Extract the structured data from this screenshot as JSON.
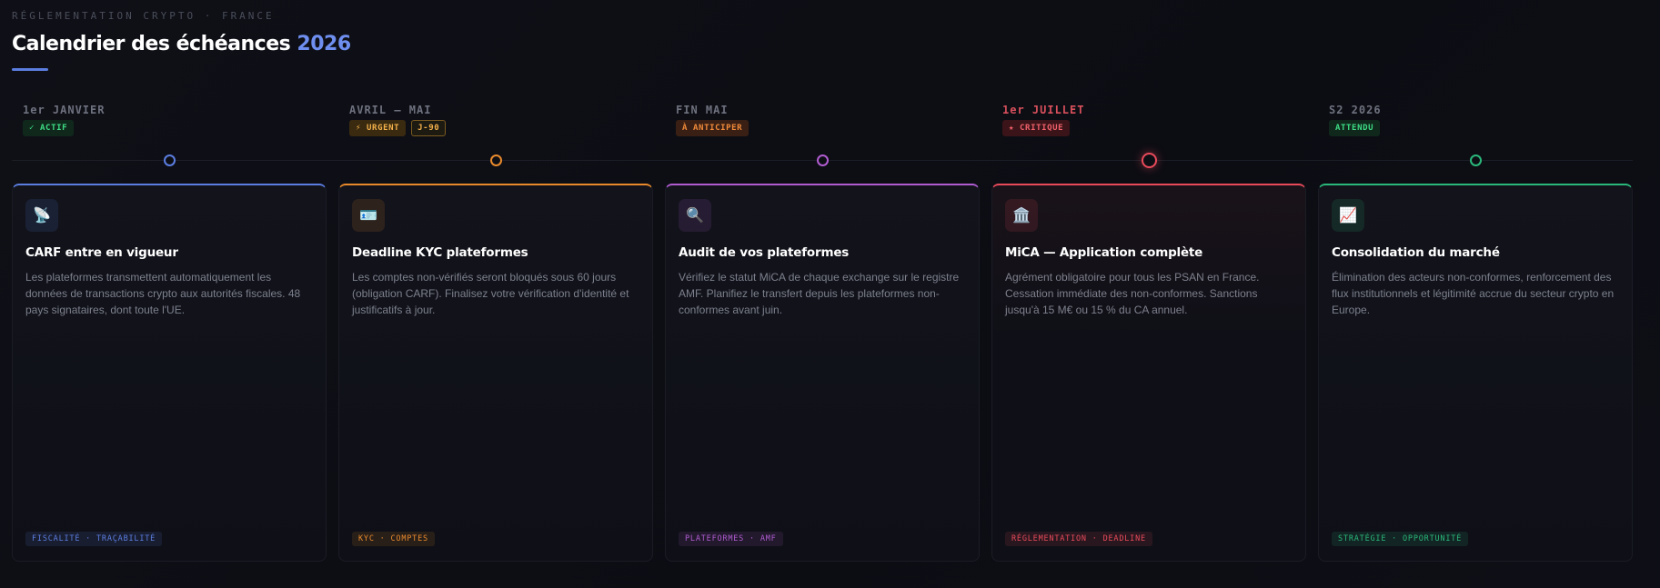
{
  "header": {
    "eyebrow": "RÉGLEMENTATION CRYPTO · FRANCE",
    "title": "Calendrier des échéances",
    "year": "2026"
  },
  "columns": [
    {
      "date": "1er JANVIER",
      "color": "#5b7de0",
      "badges": [
        {
          "label": "✓ ACTIF",
          "fg": "#3ddc84",
          "bg": "#10281c",
          "border": "#10281c"
        }
      ],
      "icon": "satellite-dish-icon",
      "icon_glyph": "📡",
      "title": "CARF entre en vigueur",
      "description": "Les plateformes transmettent automatiquement les données de transactions crypto aux autorités fiscales. 48 pays signataires, dont toute l'UE.",
      "tag": "FISCALITÉ · TRAÇABILITÉ"
    },
    {
      "date": "AVRIL — MAI",
      "color": "#e88a2c",
      "badges": [
        {
          "label": "⚡ URGENT",
          "fg": "#f2b04a",
          "bg": "#3a2a10",
          "border": "#3a2a10"
        },
        {
          "label": "J-90",
          "fg": "#f2b04a",
          "bg": "#1d1a12",
          "border": "#7a5a20"
        }
      ],
      "icon": "id-card-icon",
      "icon_glyph": "🪪",
      "title": "Deadline KYC plateformes",
      "description": "Les comptes non-vérifiés seront bloqués sous 60 jours (obligation CARF). Finalisez votre vérification d'identité et justificatifs à jour.",
      "tag": "KYC · COMPTES"
    },
    {
      "date": "FIN MAI",
      "color": "#b05cd0",
      "badges": [
        {
          "label": "À ANTICIPER",
          "fg": "#f08a3a",
          "bg": "#3a2014",
          "border": "#3a2014"
        }
      ],
      "icon": "magnifier-icon",
      "icon_glyph": "🔍",
      "title": "Audit de vos plateformes",
      "description": "Vérifiez le statut MiCA de chaque exchange sur le registre AMF. Planifiez le transfert depuis les plateformes non-conformes avant juin.",
      "tag": "PLATEFORMES · AMF"
    },
    {
      "date": "1er JUILLET",
      "color": "#e84a5a",
      "badges": [
        {
          "label": "★ CRITIQUE",
          "fg": "#f0606a",
          "bg": "#3a1418",
          "border": "#3a1418"
        }
      ],
      "icon": "bank-icon",
      "icon_glyph": "🏛️",
      "title": "MiCA — Application complète",
      "description": "Agrément obligatoire pour tous les PSAN en France. Cessation immédiate des non-conformes. Sanctions jusqu'à 15 M€ ou 15 % du CA annuel.",
      "tag": "RÉGLEMENTATION · DEADLINE"
    },
    {
      "date": "S2 2026",
      "color": "#2ab87a",
      "badges": [
        {
          "label": "ATTENDU",
          "fg": "#3ddc84",
          "bg": "#10281c",
          "border": "#10281c"
        }
      ],
      "icon": "chart-up-icon",
      "icon_glyph": "📈",
      "title": "Consolidation du marché",
      "description": "Élimination des acteurs non-conformes, renforcement des flux institutionnels et légitimité accrue du secteur crypto en Europe.",
      "tag": "STRATÉGIE · OPPORTUNITÉ"
    }
  ]
}
